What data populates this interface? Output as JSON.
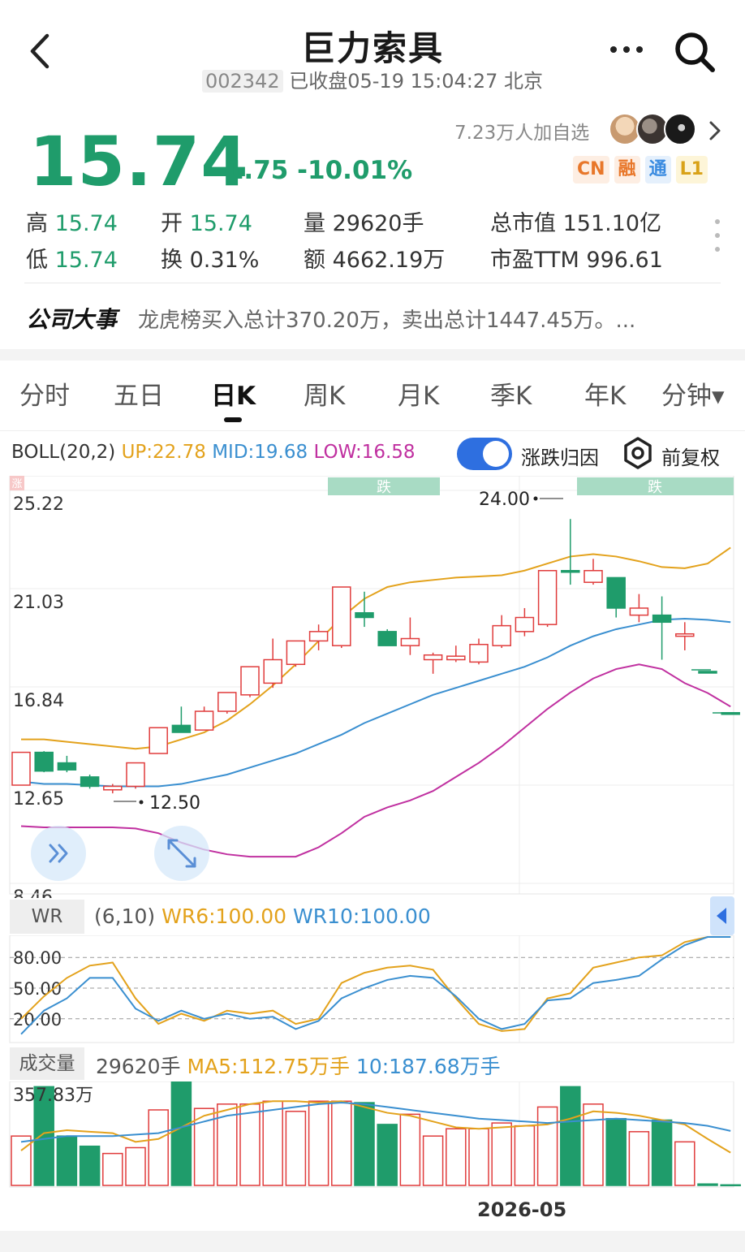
{
  "header": {
    "title": "巨力索具",
    "code": "002342",
    "status": "已收盘05-19 15:04:27 北京"
  },
  "quote": {
    "price": "15.74",
    "change": "-1.75",
    "change_pct": "-10.01%",
    "watchers": "7.23万人加自选",
    "tags": [
      "CN",
      "融",
      "通",
      "L1"
    ]
  },
  "stats": {
    "high_label": "高",
    "high": "15.74",
    "low_label": "低",
    "low": "15.74",
    "open_label": "开",
    "open": "15.74",
    "turnover_label": "换",
    "turnover": "0.31%",
    "volume_label": "量",
    "volume": "29620手",
    "amount_label": "额",
    "amount": "4662.19万",
    "mktcap_label": "总市值",
    "mktcap": "151.10亿",
    "pe_label": "市盈TTM",
    "pe": "996.61"
  },
  "news": {
    "label": "公司大事",
    "text": "龙虎榜买入总计370.20万，卖出总计1447.45万。..."
  },
  "tabs": [
    {
      "label": "分时"
    },
    {
      "label": "五日"
    },
    {
      "label": "日K"
    },
    {
      "label": "周K"
    },
    {
      "label": "月K"
    },
    {
      "label": "季K"
    },
    {
      "label": "年K"
    },
    {
      "label": "分钟▾"
    }
  ],
  "indicator": {
    "boll_name": "BOLL(20,2)",
    "up": "UP:22.78",
    "mid": "MID:19.68",
    "low": "LOW:16.58",
    "toggle_label": "涨跌归因",
    "adjust_label": "前复权",
    "toggle_on": true
  },
  "colors": {
    "down": "#1f9c6b",
    "up": "#e03c3c",
    "boll_up": "#e3a21c",
    "boll_mid": "#3a8fd0",
    "boll_low": "#c030a0"
  },
  "chart_data": {
    "type": "candlestick",
    "y_ticks": [
      "25.22",
      "21.03",
      "16.84",
      "12.65",
      "8.46"
    ],
    "ylim": [
      8.46,
      25.22
    ],
    "max_label": "24.00",
    "min_label": "12.50",
    "event_badges": [
      "跌",
      "跌"
    ],
    "corner_badge": "涨",
    "candles": [
      {
        "o": 12.65,
        "c": 14.05,
        "h": 14.05,
        "l": 12.65,
        "up": true
      },
      {
        "o": 14.05,
        "c": 13.25,
        "h": 14.1,
        "l": 13.2,
        "up": false
      },
      {
        "o": 13.6,
        "c": 13.3,
        "h": 13.9,
        "l": 13.2,
        "up": false
      },
      {
        "o": 13.0,
        "c": 12.6,
        "h": 13.1,
        "l": 12.5,
        "up": false
      },
      {
        "o": 12.45,
        "c": 12.6,
        "h": 12.7,
        "l": 12.3,
        "up": true
      },
      {
        "o": 12.6,
        "c": 13.6,
        "h": 13.6,
        "l": 12.5,
        "up": true
      },
      {
        "o": 14.0,
        "c": 15.1,
        "h": 15.1,
        "l": 14.0,
        "up": true
      },
      {
        "o": 15.2,
        "c": 14.9,
        "h": 16.0,
        "l": 14.9,
        "up": false
      },
      {
        "o": 15.0,
        "c": 15.8,
        "h": 16.0,
        "l": 15.0,
        "up": true
      },
      {
        "o": 15.8,
        "c": 16.6,
        "h": 16.6,
        "l": 15.7,
        "up": true
      },
      {
        "o": 16.5,
        "c": 17.7,
        "h": 17.7,
        "l": 16.4,
        "up": true
      },
      {
        "o": 17.0,
        "c": 18.0,
        "h": 18.9,
        "l": 16.8,
        "up": true
      },
      {
        "o": 17.8,
        "c": 18.8,
        "h": 18.8,
        "l": 17.7,
        "up": true
      },
      {
        "o": 18.8,
        "c": 19.2,
        "h": 19.5,
        "l": 18.4,
        "up": true
      },
      {
        "o": 18.6,
        "c": 21.1,
        "h": 21.1,
        "l": 18.5,
        "up": true
      },
      {
        "o": 20.0,
        "c": 19.8,
        "h": 20.9,
        "l": 19.4,
        "up": false
      },
      {
        "o": 19.2,
        "c": 18.6,
        "h": 19.3,
        "l": 18.6,
        "up": false
      },
      {
        "o": 18.6,
        "c": 18.9,
        "h": 19.8,
        "l": 18.2,
        "up": true
      },
      {
        "o": 18.2,
        "c": 18.0,
        "h": 18.3,
        "l": 17.4,
        "up": true
      },
      {
        "o": 18.0,
        "c": 18.15,
        "h": 18.6,
        "l": 17.9,
        "up": true
      },
      {
        "o": 17.9,
        "c": 18.65,
        "h": 18.9,
        "l": 17.8,
        "up": true
      },
      {
        "o": 18.6,
        "c": 19.45,
        "h": 19.9,
        "l": 18.5,
        "up": true
      },
      {
        "o": 19.2,
        "c": 19.8,
        "h": 20.2,
        "l": 19.0,
        "up": true
      },
      {
        "o": 19.5,
        "c": 21.8,
        "h": 21.8,
        "l": 19.4,
        "up": true
      },
      {
        "o": 21.8,
        "c": 21.8,
        "h": 24.0,
        "l": 21.2,
        "up": false
      },
      {
        "o": 21.3,
        "c": 21.8,
        "h": 22.3,
        "l": 21.2,
        "up": true
      },
      {
        "o": 21.5,
        "c": 20.2,
        "h": 21.5,
        "l": 19.8,
        "up": false
      },
      {
        "o": 19.9,
        "c": 20.2,
        "h": 20.8,
        "l": 19.6,
        "up": true
      },
      {
        "o": 19.9,
        "c": 19.6,
        "h": 20.7,
        "l": 18.0,
        "up": false
      },
      {
        "o": 19.0,
        "c": 19.1,
        "h": 19.6,
        "l": 18.4,
        "up": true
      },
      {
        "o": 17.5,
        "c": 17.5,
        "h": 17.5,
        "l": 17.5,
        "up": false
      },
      {
        "o": 15.74,
        "c": 15.74,
        "h": 15.74,
        "l": 15.74,
        "up": false
      }
    ],
    "boll_up": [
      14.6,
      14.6,
      14.5,
      14.4,
      14.3,
      14.2,
      14.3,
      14.6,
      14.9,
      15.4,
      16.1,
      16.9,
      17.8,
      18.8,
      19.8,
      20.6,
      21.1,
      21.3,
      21.4,
      21.5,
      21.55,
      21.6,
      21.8,
      22.1,
      22.4,
      22.5,
      22.4,
      22.2,
      21.95,
      21.9,
      22.1,
      22.78
    ],
    "boll_mid": [
      12.8,
      12.7,
      12.7,
      12.65,
      12.6,
      12.6,
      12.6,
      12.7,
      12.9,
      13.1,
      13.4,
      13.7,
      14.0,
      14.4,
      14.8,
      15.3,
      15.7,
      16.1,
      16.5,
      16.8,
      17.1,
      17.4,
      17.7,
      18.1,
      18.6,
      19.0,
      19.3,
      19.5,
      19.7,
      19.75,
      19.7,
      19.6
    ],
    "boll_low": [
      10.9,
      10.85,
      10.85,
      10.85,
      10.85,
      10.8,
      10.6,
      10.2,
      9.9,
      9.7,
      9.6,
      9.6,
      9.6,
      10.0,
      10.6,
      11.3,
      11.7,
      12.0,
      12.4,
      13.0,
      13.6,
      14.3,
      15.1,
      15.9,
      16.6,
      17.2,
      17.6,
      17.8,
      17.6,
      17.0,
      16.58,
      16.0
    ]
  },
  "wr": {
    "name": "WR",
    "params": "(6,10)",
    "wr6": "WR6:100.00",
    "wr10": "WR10:100.00",
    "ticks": [
      "80.00",
      "50.00",
      "20.00"
    ],
    "wr6_values": [
      20,
      42,
      60,
      72,
      75,
      40,
      15,
      25,
      18,
      28,
      25,
      28,
      15,
      20,
      55,
      65,
      70,
      72,
      68,
      40,
      15,
      8,
      10,
      40,
      45,
      70,
      75,
      80,
      82,
      95,
      100,
      100
    ],
    "wr10_values": [
      5,
      28,
      40,
      60,
      60,
      30,
      18,
      28,
      20,
      25,
      20,
      22,
      10,
      18,
      40,
      50,
      58,
      62,
      60,
      42,
      20,
      10,
      15,
      38,
      40,
      55,
      58,
      62,
      78,
      92,
      100,
      100
    ]
  },
  "volume": {
    "name": "成交量",
    "value": "29620手",
    "ma5": "MA5:112.75万手",
    "ma10": "10:187.68万手",
    "max_label": "357.83万",
    "date_label": "2026-05",
    "bars": [
      {
        "v": 170,
        "up": true
      },
      {
        "v": 340,
        "up": false
      },
      {
        "v": 170,
        "up": false
      },
      {
        "v": 135,
        "up": false
      },
      {
        "v": 110,
        "up": true
      },
      {
        "v": 130,
        "up": true
      },
      {
        "v": 260,
        "up": true
      },
      {
        "v": 357,
        "up": false
      },
      {
        "v": 265,
        "up": true
      },
      {
        "v": 280,
        "up": true
      },
      {
        "v": 280,
        "up": true
      },
      {
        "v": 290,
        "up": true
      },
      {
        "v": 255,
        "up": true
      },
      {
        "v": 290,
        "up": true
      },
      {
        "v": 290,
        "up": true
      },
      {
        "v": 285,
        "up": false
      },
      {
        "v": 210,
        "up": false
      },
      {
        "v": 245,
        "up": true
      },
      {
        "v": 170,
        "up": true
      },
      {
        "v": 195,
        "up": true
      },
      {
        "v": 195,
        "up": true
      },
      {
        "v": 215,
        "up": true
      },
      {
        "v": 205,
        "up": true
      },
      {
        "v": 270,
        "up": true
      },
      {
        "v": 340,
        "up": false
      },
      {
        "v": 280,
        "up": true
      },
      {
        "v": 230,
        "up": false
      },
      {
        "v": 185,
        "up": true
      },
      {
        "v": 225,
        "up": false
      },
      {
        "v": 150,
        "up": true
      },
      {
        "v": 5,
        "up": false
      },
      {
        "v": 2,
        "up": false
      }
    ],
    "ma5_values": [
      120,
      180,
      190,
      185,
      180,
      150,
      160,
      200,
      240,
      260,
      280,
      290,
      290,
      285,
      290,
      270,
      250,
      240,
      220,
      200,
      195,
      200,
      205,
      210,
      230,
      255,
      250,
      240,
      225,
      210,
      160,
      112.75
    ],
    "ma10_values": [
      150,
      160,
      170,
      170,
      170,
      175,
      180,
      200,
      220,
      240,
      250,
      260,
      270,
      280,
      285,
      280,
      270,
      260,
      250,
      240,
      230,
      225,
      220,
      215,
      220,
      225,
      230,
      225,
      220,
      215,
      205,
      187.68
    ]
  }
}
